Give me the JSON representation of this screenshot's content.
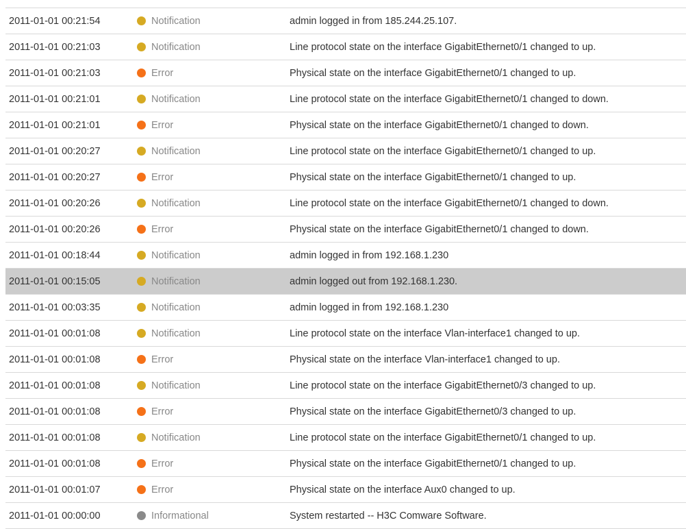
{
  "colors": {
    "Notification": "#d6aa23",
    "Error": "#f57118",
    "Informational": "#8a8a8a",
    "selected_row_bg": "#cccccc"
  },
  "logs": [
    {
      "time": "2011-01-01 00:21:54",
      "level": "Notification",
      "desc": "admin logged in from 185.244.25.107."
    },
    {
      "time": "2011-01-01 00:21:03",
      "level": "Notification",
      "desc": "Line protocol state on the interface GigabitEthernet0/1 changed to up."
    },
    {
      "time": "2011-01-01 00:21:03",
      "level": "Error",
      "desc": "Physical state on the interface GigabitEthernet0/1 changed to up."
    },
    {
      "time": "2011-01-01 00:21:01",
      "level": "Notification",
      "desc": "Line protocol state on the interface GigabitEthernet0/1 changed to down."
    },
    {
      "time": "2011-01-01 00:21:01",
      "level": "Error",
      "desc": "Physical state on the interface GigabitEthernet0/1 changed to down."
    },
    {
      "time": "2011-01-01 00:20:27",
      "level": "Notification",
      "desc": "Line protocol state on the interface GigabitEthernet0/1 changed to up."
    },
    {
      "time": "2011-01-01 00:20:27",
      "level": "Error",
      "desc": "Physical state on the interface GigabitEthernet0/1 changed to up."
    },
    {
      "time": "2011-01-01 00:20:26",
      "level": "Notification",
      "desc": "Line protocol state on the interface GigabitEthernet0/1 changed to down."
    },
    {
      "time": "2011-01-01 00:20:26",
      "level": "Error",
      "desc": "Physical state on the interface GigabitEthernet0/1 changed to down."
    },
    {
      "time": "2011-01-01 00:18:44",
      "level": "Notification",
      "desc": "admin logged in from 192.168.1.230"
    },
    {
      "time": "2011-01-01 00:15:05",
      "level": "Notification",
      "desc": "admin logged out from 192.168.1.230.",
      "selected": true
    },
    {
      "time": "2011-01-01 00:03:35",
      "level": "Notification",
      "desc": "admin logged in from 192.168.1.230"
    },
    {
      "time": "2011-01-01 00:01:08",
      "level": "Notification",
      "desc": "Line protocol state on the interface Vlan-interface1 changed to up."
    },
    {
      "time": "2011-01-01 00:01:08",
      "level": "Error",
      "desc": "Physical state on the interface Vlan-interface1 changed to up."
    },
    {
      "time": "2011-01-01 00:01:08",
      "level": "Notification",
      "desc": "Line protocol state on the interface GigabitEthernet0/3 changed to up."
    },
    {
      "time": "2011-01-01 00:01:08",
      "level": "Error",
      "desc": "Physical state on the interface GigabitEthernet0/3 changed to up."
    },
    {
      "time": "2011-01-01 00:01:08",
      "level": "Notification",
      "desc": "Line protocol state on the interface GigabitEthernet0/1 changed to up."
    },
    {
      "time": "2011-01-01 00:01:08",
      "level": "Error",
      "desc": "Physical state on the interface GigabitEthernet0/1 changed to up."
    },
    {
      "time": "2011-01-01 00:01:07",
      "level": "Error",
      "desc": "Physical state on the interface Aux0 changed to up."
    },
    {
      "time": "2011-01-01 00:00:00",
      "level": "Informational",
      "desc": "System restarted -- H3C Comware Software."
    }
  ]
}
